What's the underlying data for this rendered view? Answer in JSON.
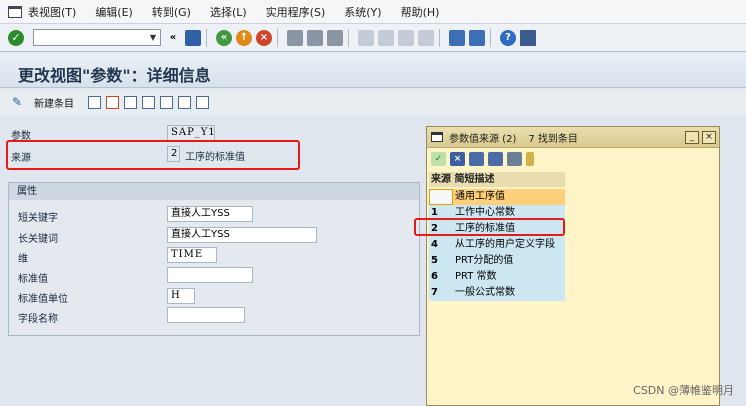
{
  "menubar": {
    "items": [
      "表视图(T)",
      "编辑(E)",
      "转到(G)",
      "选择(L)",
      "实用程序(S)",
      "系统(Y)",
      "帮助(H)"
    ]
  },
  "toolbar": {
    "command_field_value": "",
    "back_glyph": "«"
  },
  "title": "更改视图\"参数\"：详细信息",
  "app_toolbar": {
    "new_entries_label": "新建条目"
  },
  "fields": {
    "param_label": "参数",
    "param_value": "SAP_Y1",
    "source_label": "来源",
    "source_key": "2",
    "source_text": "工序的标准值"
  },
  "group": {
    "title": "属性",
    "rows": [
      {
        "label": "短关键字",
        "value": "直接人工YSS"
      },
      {
        "label": "长关键词",
        "value": "直接人工YSS"
      },
      {
        "label": "维",
        "value": "TIME"
      },
      {
        "label": "标准值",
        "value": ""
      },
      {
        "label": "标准值单位",
        "value": "H"
      },
      {
        "label": "字段名称",
        "value": ""
      }
    ]
  },
  "popup": {
    "title": "参数值来源 (2)",
    "hits": "7 找到条目",
    "header": "来源 简短描述",
    "rows": [
      {
        "key": "",
        "text": "通用工序值"
      },
      {
        "key": "1",
        "text": "工作中心常数"
      },
      {
        "key": "2",
        "text": "工序的标准值"
      },
      {
        "key": "4",
        "text": "从工序的用户定义字段"
      },
      {
        "key": "5",
        "text": "PRT分配的值"
      },
      {
        "key": "6",
        "text": "PRT 常数"
      },
      {
        "key": "7",
        "text": "一般公式常数"
      }
    ]
  },
  "watermark": "CSDN @薄帷鉴明月",
  "icons": {
    "menu": "menu-icon",
    "enter": "check-icon",
    "save": "save-icon",
    "help": "help-icon"
  },
  "colors": {
    "highlight_border": "#e41b17",
    "popup_background": "#fff3c8",
    "selected_row": "#ffd07c",
    "key_cell": "#cce7f2"
  }
}
